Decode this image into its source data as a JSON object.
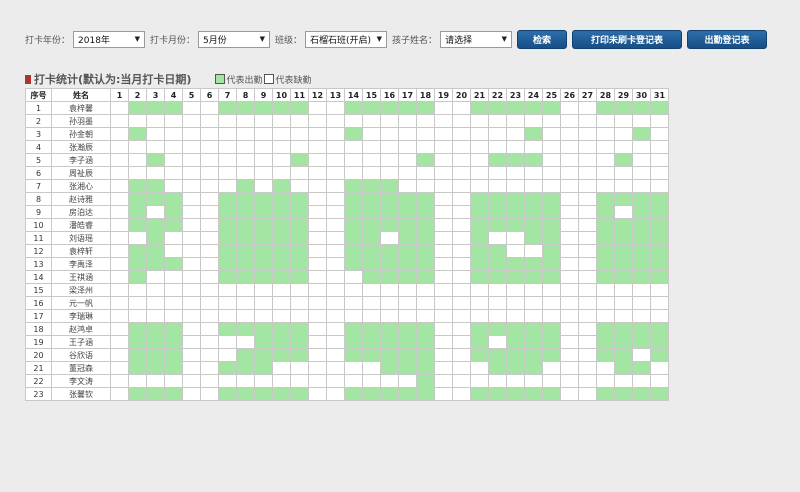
{
  "filters": {
    "year_label": "打卡年份：",
    "year_value": "2018年",
    "month_label": "打卡月份：",
    "month_value": "5月份",
    "class_label": "班级：",
    "class_value": "石榴石班(开启)",
    "child_label": "孩子姓名：",
    "child_value": "请选择"
  },
  "buttons": {
    "search": "检索",
    "print": "打印未刷卡登记表",
    "attendance": "出勤登记表"
  },
  "section": {
    "title": "打卡统计(默认为:当月打卡日期)",
    "legend_present": "代表出勤",
    "legend_absent": "代表缺勤"
  },
  "colors": {
    "present": "#a3e5a3",
    "absent": "#ffffff",
    "button": "#1f5f9c",
    "title_mark": "#aa3333"
  },
  "table": {
    "col_index": "序号",
    "col_name": "姓名",
    "days": [
      "1",
      "2",
      "3",
      "4",
      "5",
      "6",
      "7",
      "8",
      "9",
      "10",
      "11",
      "12",
      "13",
      "14",
      "15",
      "16",
      "17",
      "18",
      "19",
      "20",
      "21",
      "22",
      "23",
      "24",
      "25",
      "26",
      "27",
      "28",
      "29",
      "30",
      "31"
    ],
    "rows": [
      {
        "no": "1",
        "name": "袁梓馨",
        "days": "0111001111100111110011111001111"
      },
      {
        "no": "2",
        "name": "孙羽墨",
        "days": "0000000000000000000000000000000"
      },
      {
        "no": "3",
        "name": "孙金朝",
        "days": "0100000000000100000000010000010"
      },
      {
        "no": "4",
        "name": "张瀚辰",
        "days": "0000000000000000000000000000000"
      },
      {
        "no": "5",
        "name": "李子涵",
        "days": "0010000000100000010001110000100"
      },
      {
        "no": "6",
        "name": "周祉辰",
        "days": "0000000000000000000000000000000"
      },
      {
        "no": "7",
        "name": "张湘心",
        "days": "0110000101000111000000000000000"
      },
      {
        "no": "8",
        "name": "赵诗雅",
        "days": "0111001111100111110011111001111"
      },
      {
        "no": "9",
        "name": "房泊达",
        "days": "0101001111100111110011111001011"
      },
      {
        "no": "10",
        "name": "潘皓睿",
        "days": "0111001111100111110011111001111"
      },
      {
        "no": "11",
        "name": "刘语瑶",
        "days": "0010001111100110110010011001111"
      },
      {
        "no": "12",
        "name": "袁梓轩",
        "days": "0110001111100111110011001001111"
      },
      {
        "no": "13",
        "name": "李禹泽",
        "days": "0111001111100111110011111001111"
      },
      {
        "no": "14",
        "name": "王祺涵",
        "days": "0100001111100011110011111001111"
      },
      {
        "no": "15",
        "name": "梁泽州",
        "days": "0000000000000000000000000000000"
      },
      {
        "no": "16",
        "name": "元一帆",
        "days": "0000000000000000000000000000000"
      },
      {
        "no": "17",
        "name": "李瑞琳",
        "days": "0000000000000000000000000000000"
      },
      {
        "no": "18",
        "name": "赵鸿卓",
        "days": "0111001111100111110011111001111"
      },
      {
        "no": "19",
        "name": "王子涵",
        "days": "0111000011100111110010111001111"
      },
      {
        "no": "20",
        "name": "谷欣语",
        "days": "0111000111100111110011111001101"
      },
      {
        "no": "21",
        "name": "董冠森",
        "days": "0111001110000001110001110000110"
      },
      {
        "no": "22",
        "name": "李文涛",
        "days": "0000000000000000010000000000000"
      },
      {
        "no": "23",
        "name": "张馨钦",
        "days": "0111001111100111110011111001111"
      }
    ]
  }
}
